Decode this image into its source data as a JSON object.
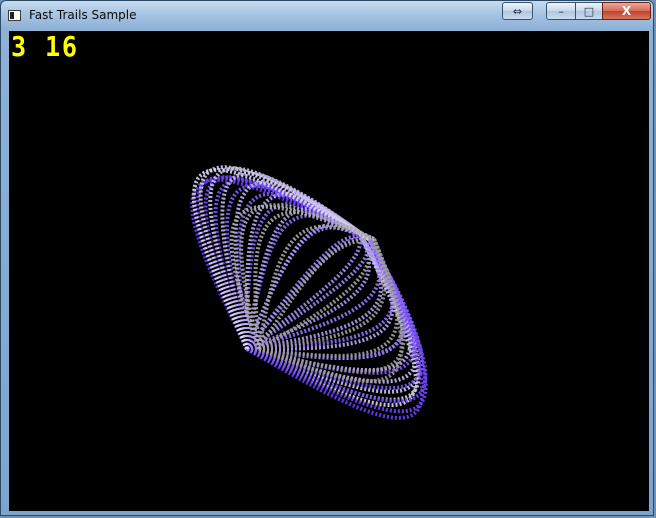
{
  "window": {
    "title": "Fast Trails Sample",
    "icon": "app-window-icon",
    "controls": {
      "resize_glyph": "⇔",
      "minimize_glyph": "–",
      "maximize_glyph": "□",
      "close_glyph": "X"
    }
  },
  "viewport": {
    "counter": "3 16",
    "background": "#000000",
    "counter_color": "#ffff00",
    "trail_colors": {
      "primary": "#6a3cff",
      "secondary": "#dcd8f0",
      "fade": "#9a9a9a"
    }
  }
}
